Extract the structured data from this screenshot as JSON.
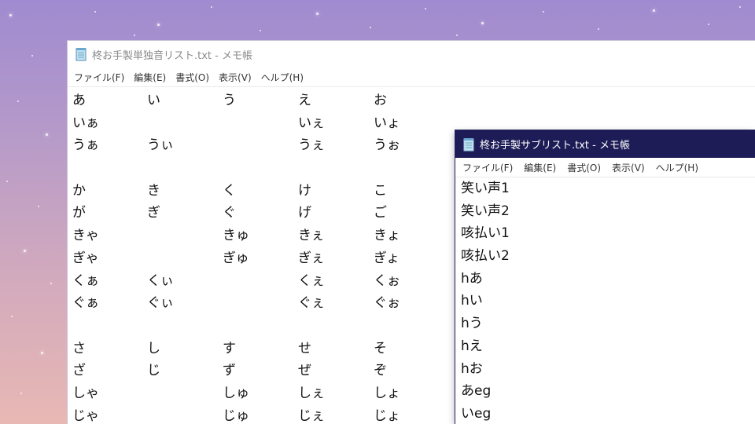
{
  "colors": {
    "title_active": "#1e1c57",
    "title_inactive_text": "#8a8a8a",
    "editor_bg": "#ffffff"
  },
  "window1": {
    "title": "柊お手製単独音リスト.txt - メモ帳",
    "icon": "notepad-icon",
    "menu": [
      "ファイル(F)",
      "編集(E)",
      "書式(O)",
      "表示(V)",
      "ヘルプ(H)"
    ],
    "rows": [
      [
        "あ",
        "い",
        "う",
        "え",
        "お"
      ],
      [
        "いぁ",
        "",
        "",
        "いぇ",
        "いょ"
      ],
      [
        "うぁ",
        "うぃ",
        "",
        "うぇ",
        "うぉ"
      ],
      [
        "",
        "",
        "",
        "",
        ""
      ],
      [
        "か",
        "き",
        "く",
        "け",
        "こ"
      ],
      [
        "が",
        "ぎ",
        "ぐ",
        "げ",
        "ご"
      ],
      [
        "きゃ",
        "",
        "きゅ",
        "きぇ",
        "きょ"
      ],
      [
        "ぎゃ",
        "",
        "ぎゅ",
        "ぎぇ",
        "ぎょ"
      ],
      [
        "くぁ",
        "くぃ",
        "",
        "くぇ",
        "くぉ"
      ],
      [
        "ぐぁ",
        "ぐぃ",
        "",
        "ぐぇ",
        "ぐぉ"
      ],
      [
        "",
        "",
        "",
        "",
        ""
      ],
      [
        "さ",
        "し",
        "す",
        "せ",
        "そ"
      ],
      [
        "ざ",
        "じ",
        "ず",
        "ぜ",
        "ぞ"
      ],
      [
        "しゃ",
        "",
        "しゅ",
        "しぇ",
        "しょ"
      ],
      [
        "じゃ",
        "",
        "じゅ",
        "じぇ",
        "じょ"
      ]
    ]
  },
  "window2": {
    "title": "柊お手製サブリスト.txt - メモ帳",
    "icon": "notepad-icon",
    "menu": [
      "ファイル(F)",
      "編集(E)",
      "書式(O)",
      "表示(V)",
      "ヘルプ(H)"
    ],
    "lines": [
      "笑い声1",
      "笑い声2",
      "咳払い1",
      "咳払い2",
      "hあ",
      "hい",
      "hう",
      "hえ",
      "hお",
      "あeg",
      "いeg"
    ]
  }
}
